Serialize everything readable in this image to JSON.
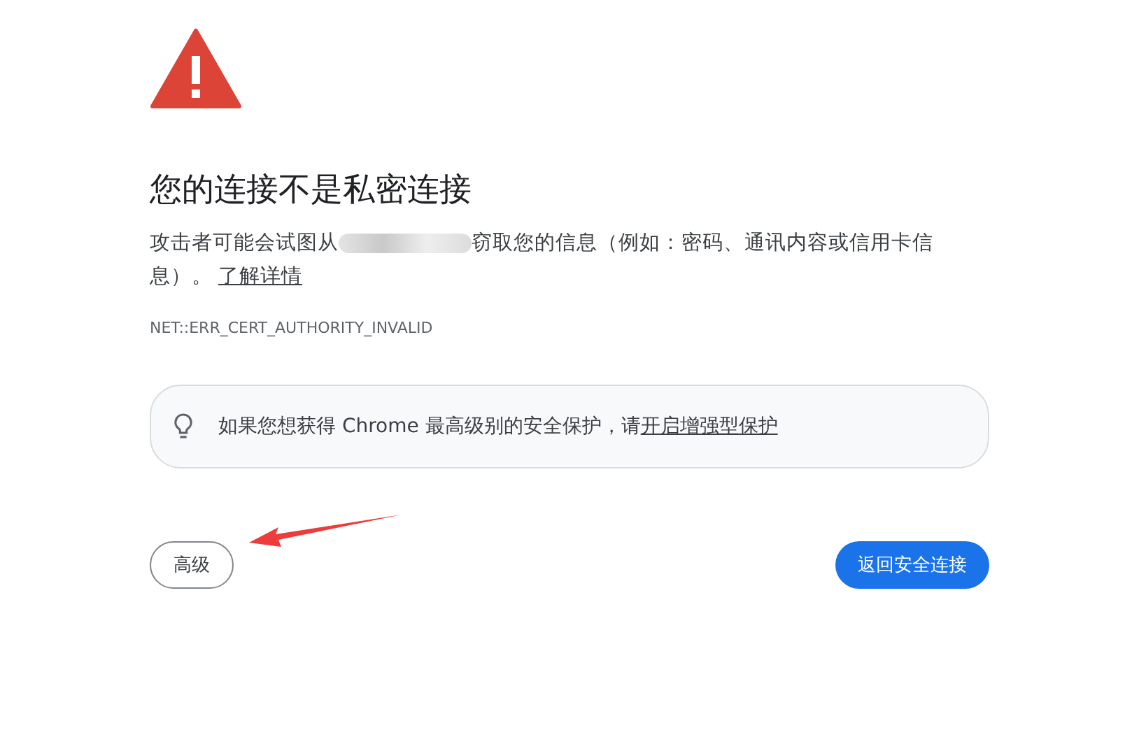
{
  "title": "您的连接不是私密连接",
  "description": {
    "before": "攻击者可能会试图从",
    "after": "窃取您的信息（例如：密码、通讯内容或信用卡信",
    "after_line2": "息）。",
    "link": "了解详情"
  },
  "error_code": "NET::ERR_CERT_AUTHORITY_INVALID",
  "tip": {
    "text": "如果您想获得 Chrome 最高级别的安全保护，请",
    "link": "开启增强型保护"
  },
  "buttons": [
    {
      "kind": "secondary",
      "label": "高级"
    },
    {
      "kind": "primary",
      "label": "返回安全连接"
    }
  ]
}
